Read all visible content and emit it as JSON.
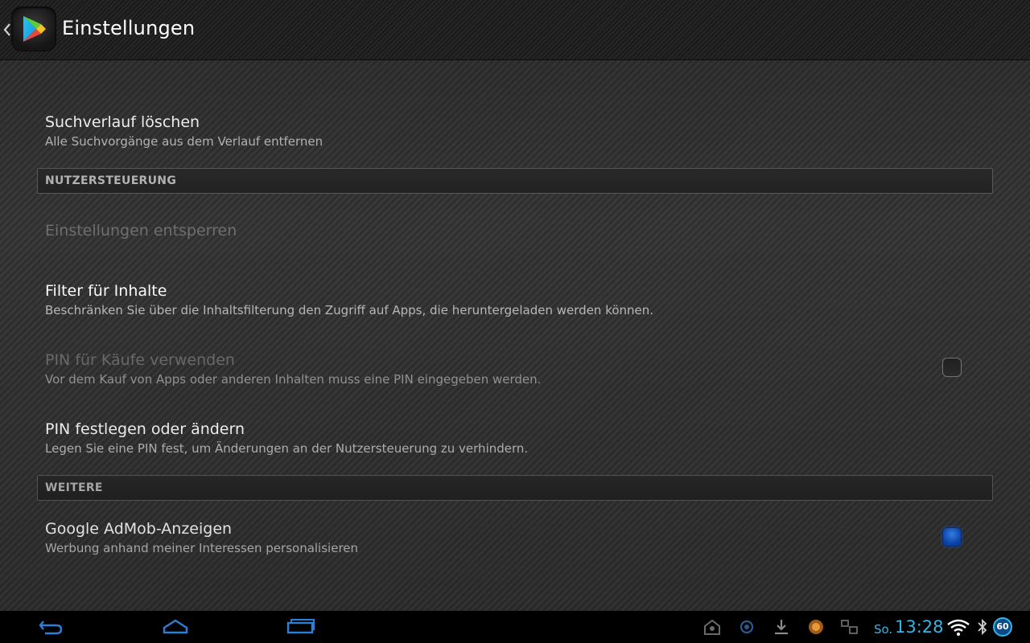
{
  "action_bar": {
    "title": "Einstellungen"
  },
  "preferences": {
    "clear_history": {
      "title": "Suchverlauf löschen",
      "summary": "Alle Suchvorgänge aus dem Verlauf entfernen"
    },
    "section_user_controls": "NUTZERSTEUERUNG",
    "unlock_settings": {
      "title": "Einstellungen entsperren"
    },
    "content_filter": {
      "title": "Filter für Inhalte",
      "summary": "Beschränken Sie über die Inhaltsfilterung den Zugriff auf Apps, die heruntergeladen werden können."
    },
    "purchase_pin": {
      "title": "PIN für Käufe verwenden",
      "summary": "Vor dem Kauf von Apps oder anderen Inhalten muss eine PIN eingegeben werden.",
      "checked": false
    },
    "set_pin": {
      "title": "PIN festlegen oder ändern",
      "summary": "Legen Sie eine PIN fest, um Änderungen an der Nutzersteuerung zu verhindern."
    },
    "section_more": "WEITERE",
    "admob": {
      "title": "Google AdMob-Anzeigen",
      "summary": "Werbung anhand meiner Interessen personalisieren",
      "checked": true
    }
  },
  "system_bar": {
    "day": "So.",
    "time": "13:28",
    "battery": "60",
    "accent_color": "#33b5e5"
  },
  "icons": [
    "back-icon",
    "home-icon",
    "recent-apps-icon",
    "notification-icon",
    "download-icon",
    "wifi-icon",
    "bluetooth-icon",
    "battery-icon",
    "google-play-icon"
  ]
}
